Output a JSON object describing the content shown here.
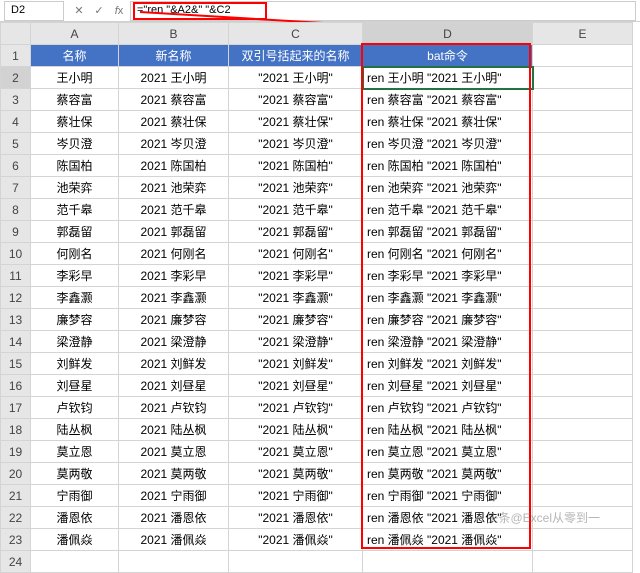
{
  "nameBox": "D2",
  "formula": "=\"ren \"&A2&\" \"&C2",
  "columns": [
    "A",
    "B",
    "C",
    "D",
    "E"
  ],
  "colHeaders": {
    "A": "名称",
    "B": "新名称",
    "C": "双引号括起来的名称",
    "D": "bat命令",
    "E": ""
  },
  "selectedCol": "D",
  "selectedRow": 2,
  "rows": [
    {
      "n": 2,
      "A": "王小明",
      "B": "2021 王小明",
      "C": "\"2021 王小明\"",
      "D": "ren 王小明 \"2021 王小明\""
    },
    {
      "n": 3,
      "A": "蔡容富",
      "B": "2021 蔡容富",
      "C": "\"2021 蔡容富\"",
      "D": "ren 蔡容富 \"2021 蔡容富\""
    },
    {
      "n": 4,
      "A": "蔡壮保",
      "B": "2021 蔡壮保",
      "C": "\"2021 蔡壮保\"",
      "D": "ren 蔡壮保 \"2021 蔡壮保\""
    },
    {
      "n": 5,
      "A": "岑贝澄",
      "B": "2021 岑贝澄",
      "C": "\"2021 岑贝澄\"",
      "D": "ren 岑贝澄 \"2021 岑贝澄\""
    },
    {
      "n": 6,
      "A": "陈国柏",
      "B": "2021 陈国柏",
      "C": "\"2021 陈国柏\"",
      "D": "ren 陈国柏 \"2021 陈国柏\""
    },
    {
      "n": 7,
      "A": "池荣弈",
      "B": "2021 池荣弈",
      "C": "\"2021 池荣弈\"",
      "D": "ren 池荣弈 \"2021 池荣弈\""
    },
    {
      "n": 8,
      "A": "范千皋",
      "B": "2021 范千皋",
      "C": "\"2021 范千皋\"",
      "D": "ren 范千皋 \"2021 范千皋\""
    },
    {
      "n": 9,
      "A": "郭磊留",
      "B": "2021 郭磊留",
      "C": "\"2021 郭磊留\"",
      "D": "ren 郭磊留 \"2021 郭磊留\""
    },
    {
      "n": 10,
      "A": "何刚名",
      "B": "2021 何刚名",
      "C": "\"2021 何刚名\"",
      "D": "ren 何刚名 \"2021 何刚名\""
    },
    {
      "n": 11,
      "A": "李彩早",
      "B": "2021 李彩早",
      "C": "\"2021 李彩早\"",
      "D": "ren 李彩早 \"2021 李彩早\""
    },
    {
      "n": 12,
      "A": "李鑫灏",
      "B": "2021 李鑫灏",
      "C": "\"2021 李鑫灏\"",
      "D": "ren 李鑫灏 \"2021 李鑫灏\""
    },
    {
      "n": 13,
      "A": "廉梦容",
      "B": "2021 廉梦容",
      "C": "\"2021 廉梦容\"",
      "D": "ren 廉梦容 \"2021 廉梦容\""
    },
    {
      "n": 14,
      "A": "梁澄静",
      "B": "2021 梁澄静",
      "C": "\"2021 梁澄静\"",
      "D": "ren 梁澄静 \"2021 梁澄静\""
    },
    {
      "n": 15,
      "A": "刘鲜发",
      "B": "2021 刘鲜发",
      "C": "\"2021 刘鲜发\"",
      "D": "ren 刘鲜发 \"2021 刘鲜发\""
    },
    {
      "n": 16,
      "A": "刘昼星",
      "B": "2021 刘昼星",
      "C": "\"2021 刘昼星\"",
      "D": "ren 刘昼星 \"2021 刘昼星\""
    },
    {
      "n": 17,
      "A": "卢钦钧",
      "B": "2021 卢钦钧",
      "C": "\"2021 卢钦钧\"",
      "D": "ren 卢钦钧 \"2021 卢钦钧\""
    },
    {
      "n": 18,
      "A": "陆丛枫",
      "B": "2021 陆丛枫",
      "C": "\"2021 陆丛枫\"",
      "D": "ren 陆丛枫 \"2021 陆丛枫\""
    },
    {
      "n": 19,
      "A": "莫立恩",
      "B": "2021 莫立恩",
      "C": "\"2021 莫立恩\"",
      "D": "ren 莫立恩 \"2021 莫立恩\""
    },
    {
      "n": 20,
      "A": "莫两敬",
      "B": "2021 莫两敬",
      "C": "\"2021 莫两敬\"",
      "D": "ren 莫两敬 \"2021 莫两敬\""
    },
    {
      "n": 21,
      "A": "宁雨御",
      "B": "2021 宁雨御",
      "C": "\"2021 宁雨御\"",
      "D": "ren 宁雨御 \"2021 宁雨御\""
    },
    {
      "n": 22,
      "A": "潘恩依",
      "B": "2021 潘恩依",
      "C": "\"2021 潘恩依\"",
      "D": "ren 潘恩依 \"2021 潘恩依\""
    },
    {
      "n": 23,
      "A": "潘佩焱",
      "B": "2021 潘佩焱",
      "C": "\"2021 潘佩焱\"",
      "D": "ren 潘佩焱 \"2021 潘佩焱\""
    }
  ],
  "lastRow": 24,
  "watermark": "头条@Excel从零到一"
}
